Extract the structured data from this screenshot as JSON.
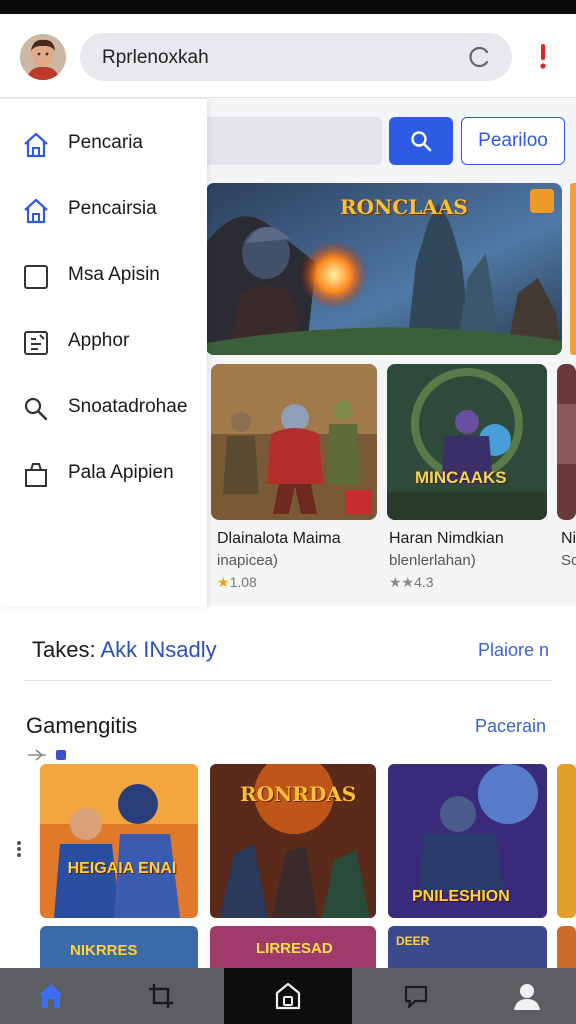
{
  "header": {
    "search_query": "Rprlenoxkah",
    "avatar": "user-avatar",
    "refresh_icon": "refresh-icon",
    "alert_icon": "alert-icon"
  },
  "drawer": {
    "items": [
      {
        "label": "Pencaria",
        "icon": "home-icon"
      },
      {
        "label": "Pencairsia",
        "icon": "home-icon"
      },
      {
        "label": "Msa Apisin",
        "icon": "square-icon"
      },
      {
        "label": "Apphor",
        "icon": "clipboard-icon"
      },
      {
        "label": "Snoatadrohae",
        "icon": "search-icon"
      },
      {
        "label": "Pala Apipien",
        "icon": "bag-icon"
      }
    ]
  },
  "main": {
    "search_button_icon": "search-icon",
    "filter_label": "Peariloo",
    "hero": {
      "title_art": "RONCLAAS"
    },
    "cards": [
      {
        "title": "Dlainalota Maima",
        "subtitle": "inapicea)",
        "rating": "1.08",
        "art_text": ""
      },
      {
        "title": "Haran Nimdkian",
        "subtitle": "blenlerlahan)",
        "rating": "4.3",
        "art_text": "MINCAAKS"
      },
      {
        "title": "Ni",
        "subtitle": "Sc",
        "rating": "",
        "art_text": ""
      }
    ]
  },
  "sections": {
    "first": {
      "title_prefix": "Takes:",
      "title_accent": "Akk INsadly",
      "link": "Plaiore n"
    },
    "second": {
      "title": "Gamengitis",
      "link": "Pacerain"
    }
  },
  "tiles": [
    {
      "art_text": "HEIGAIA ENAI"
    },
    {
      "art_text": "RONRDAS"
    },
    {
      "art_text": "PNILESHION"
    },
    {
      "art_text": ""
    }
  ],
  "tiles_row2": [
    {
      "art_text": "NIKRRES"
    },
    {
      "art_text": "LIRRESAD"
    },
    {
      "art_text": "DEER"
    },
    {
      "art_text": ""
    }
  ],
  "bottom_nav": [
    {
      "icon": "home-icon",
      "active": true
    },
    {
      "icon": "crop-icon"
    },
    {
      "icon": "store-icon"
    },
    {
      "icon": "chat-icon"
    },
    {
      "icon": "profile-icon"
    }
  ],
  "colors": {
    "accent": "#2d5be3",
    "nav_bar": "#5c5e62",
    "link": "#3a63d6"
  }
}
